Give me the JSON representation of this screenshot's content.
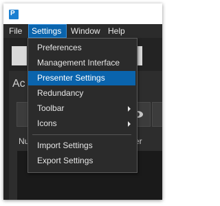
{
  "app": {
    "icon_text": "P",
    "accent_color": "#0a64ad"
  },
  "menubar": {
    "items": [
      {
        "label": "File"
      },
      {
        "label": "Settings"
      },
      {
        "label": "Window"
      },
      {
        "label": "Help"
      }
    ],
    "open_menu": "Settings"
  },
  "background": {
    "panel_title_partial": "Ac",
    "column_left_partial": "Nu",
    "column_right_partial": "nter"
  },
  "settings_menu": {
    "items": [
      {
        "label": "Preferences",
        "highlighted": false,
        "has_submenu": false
      },
      {
        "label": "Management Interface",
        "highlighted": false,
        "has_submenu": false
      },
      {
        "label": "Presenter Settings",
        "highlighted": true,
        "has_submenu": false
      },
      {
        "label": "Redundancy",
        "highlighted": false,
        "has_submenu": false
      },
      {
        "label": "Toolbar",
        "highlighted": false,
        "has_submenu": true
      },
      {
        "label": "Icons",
        "highlighted": false,
        "has_submenu": true
      },
      {
        "label": "Import Settings",
        "highlighted": false,
        "has_submenu": false
      },
      {
        "label": "Export Settings",
        "highlighted": false,
        "has_submenu": false
      }
    ]
  }
}
